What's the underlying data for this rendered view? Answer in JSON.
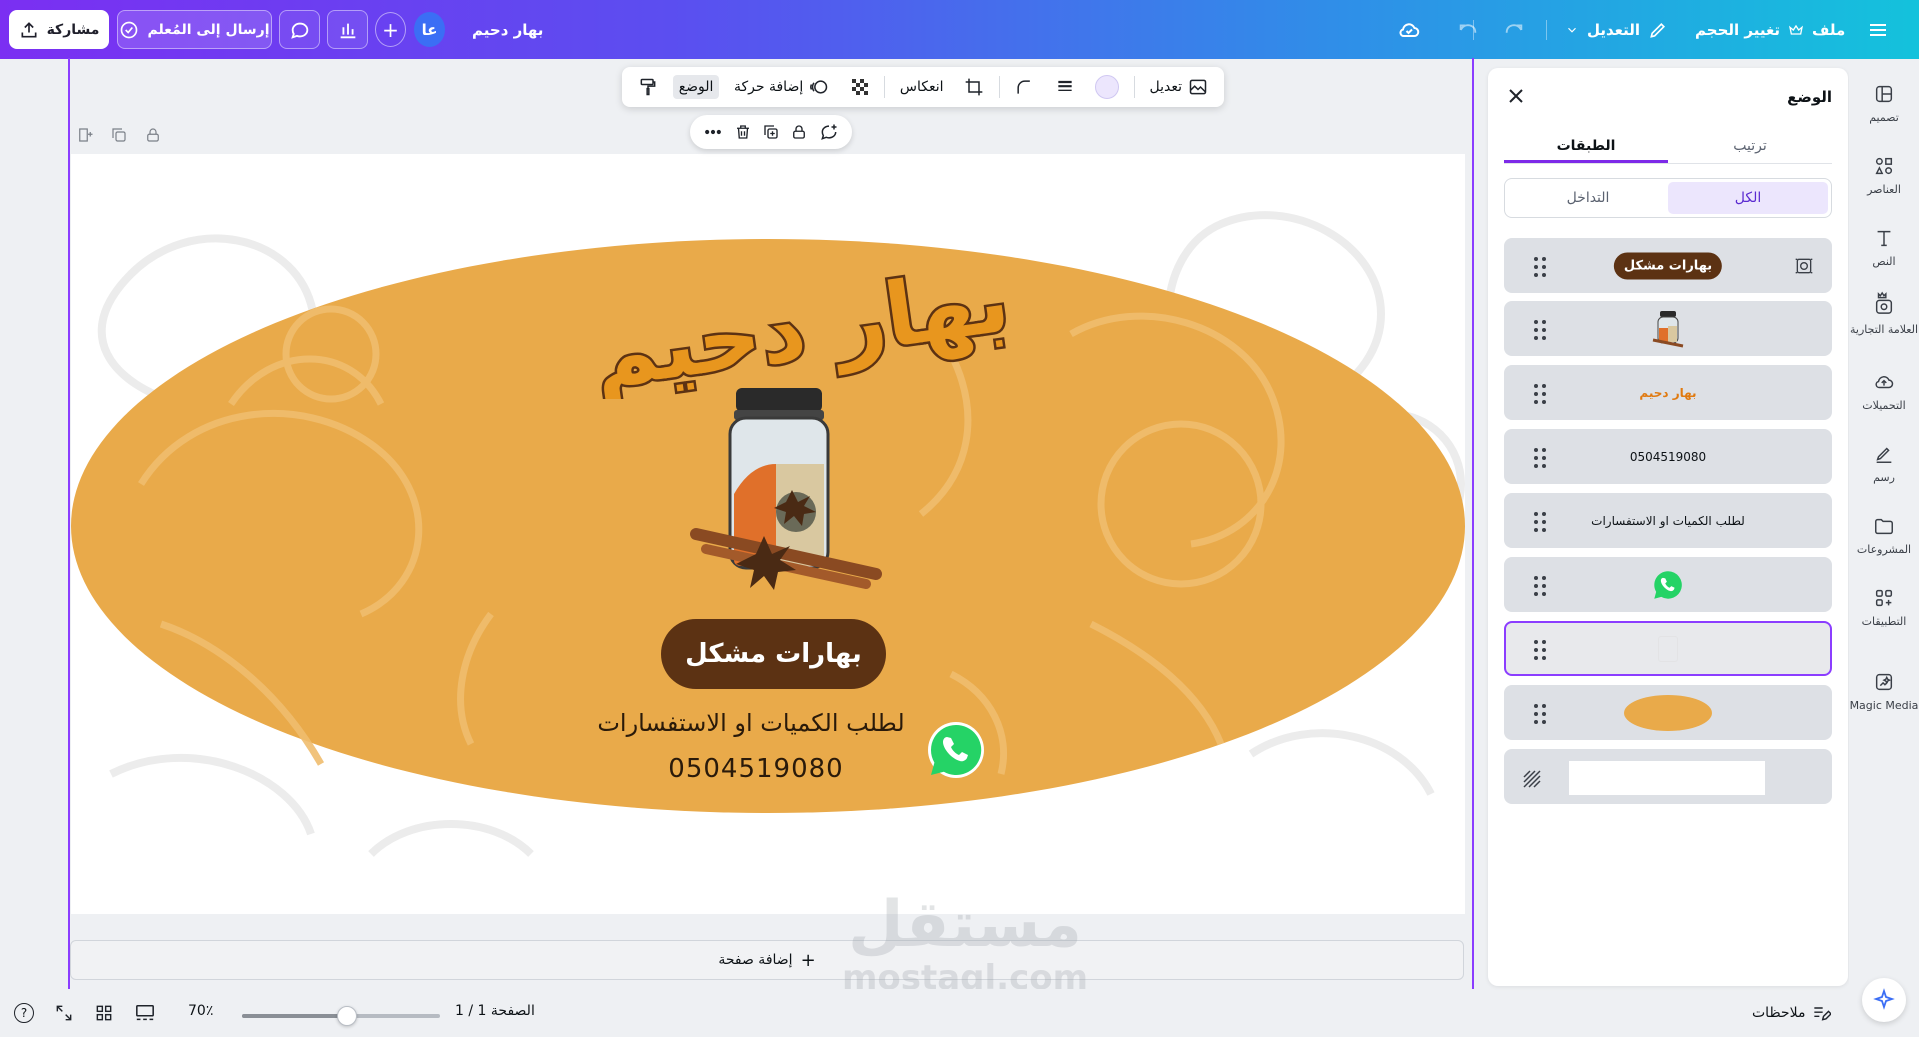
{
  "topbar": {
    "share_label": "مشاركة",
    "teacher_label": "إرسال إلى المُعلم",
    "avatar_initials": "عا",
    "plus_label": "+",
    "doc_title": "بهار دحيم",
    "edit_label": "التعديل",
    "resize_label": "تغيير الحجم",
    "file_label": "ملف"
  },
  "toolbar": {
    "edit_label": "تعديل",
    "flip_label": "انعكاس",
    "animate_label": "إضافة حركة",
    "position_label": "الوضع"
  },
  "design": {
    "brand_title": "بهار دحيم",
    "pill_text": "بهارات مشكل",
    "inquiry_text": "لطلب الكميات او الاستفسارات",
    "phone": "0504519080",
    "colors": {
      "ellipse": "#e9aa4a",
      "pill": "#5c3213",
      "title": "#e8961e",
      "title_outline": "#5c3213"
    }
  },
  "add_page_label": "إضافة صفحة",
  "bottombar": {
    "zoom_label": "70٪",
    "zoom_fraction": 0.53,
    "page_label": "الصفحة 1 / 1",
    "notes_label": "ملاحظات",
    "help_label": "?"
  },
  "panel": {
    "title": "الوضع",
    "tabs": [
      "ترتيب",
      "الطبقات"
    ],
    "active_tab": "الطبقات",
    "segments": [
      "الكل",
      "التداخل"
    ],
    "active_segment": "الكل",
    "layers": [
      {
        "type": "pill",
        "label": "بهارات مشكل"
      },
      {
        "type": "jar",
        "label": ""
      },
      {
        "type": "title",
        "label": "بهار دحيم"
      },
      {
        "type": "text",
        "label": "0504519080"
      },
      {
        "type": "text",
        "label": "لطلب الكميات او الاستفسارات"
      },
      {
        "type": "whatsapp",
        "label": ""
      },
      {
        "type": "selected",
        "label": ""
      },
      {
        "type": "ellipse",
        "label": ""
      },
      {
        "type": "background",
        "label": ""
      }
    ]
  },
  "sidebar": {
    "items": [
      "تصميم",
      "العناصر",
      "النص",
      "العلامة التجارية",
      "التحميلات",
      "رسم",
      "المشروعات",
      "التطبيقات",
      "Magic Media"
    ]
  },
  "watermark": {
    "arabic": "مستقل",
    "latin": "mostaql.com"
  }
}
